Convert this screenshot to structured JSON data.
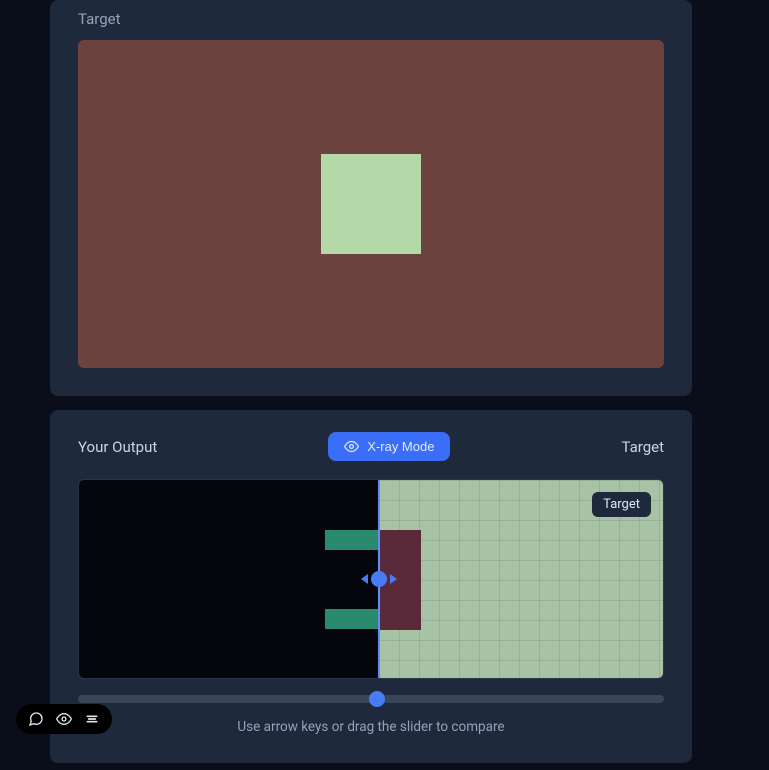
{
  "sections": {
    "target_label": "Target",
    "output_label": "Your Output",
    "compare_target_label": "Target"
  },
  "xray_button": {
    "label": "X-ray Mode"
  },
  "target_badge": "Target",
  "helper_text": "Use arrow keys or drag the slider to compare",
  "colors": {
    "target_bg": "#6c423e",
    "target_square": "#b5d8a8",
    "accent": "#4a7bf7"
  }
}
